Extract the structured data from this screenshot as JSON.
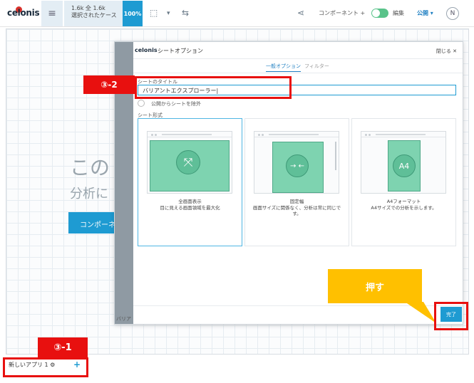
{
  "app": {
    "logo_text": "celonis",
    "menu_icon": "hamburger-icon",
    "case_stats": "1.6k 全 1.6k",
    "case_caption": "選択されたケース",
    "case_percent": "100%",
    "components_label": "コンポーネント +",
    "edit_label": "編集",
    "publish_label": "公開 ▾",
    "user_initial": "N"
  },
  "background": {
    "title_fragment": "この",
    "subtitle_fragment": "分析に",
    "button_fragment": "コンポーネン"
  },
  "dialog": {
    "title": "シートオプション",
    "close_label": "閉じる ✕",
    "tabs": [
      {
        "label": "一般オプション",
        "active": true
      },
      {
        "label": "フィルター",
        "active": false
      }
    ],
    "sheet_title_label": "シートのタイトル",
    "sheet_title_value": "バリアントエクスプローラー|",
    "exclude_label": "公開からシートを除外",
    "sheet_format_label": "シート形式",
    "formats": [
      {
        "line1": "全画面表示",
        "line2": "目に見える画面領域を最大化",
        "line3": "",
        "selected": true
      },
      {
        "line1": "固定幅",
        "line2": "画面サイズに関係なく、分析は常に同じで",
        "line3": "す。",
        "selected": false
      },
      {
        "line1": "A4フォーマット",
        "line2": "A4サイズでの分析を示します。",
        "line3": "",
        "selected": false
      }
    ],
    "a4_badge": "A4",
    "done_label": "完了",
    "hidden_edge_text": "バリア"
  },
  "sheet_bar": {
    "tab_label": "新しいアプリ 1 ⚙",
    "add_label": "+"
  },
  "annotations": {
    "step_3_1": "③-1",
    "step_3_2": "③-2",
    "callout_text": "押す",
    "color_red": "#e8100f",
    "color_callout": "#ffc000"
  },
  "colors": {
    "accent": "#1e9bd2",
    "sheet_green": "#7ed3b0",
    "toggle_green": "#59c38a"
  }
}
